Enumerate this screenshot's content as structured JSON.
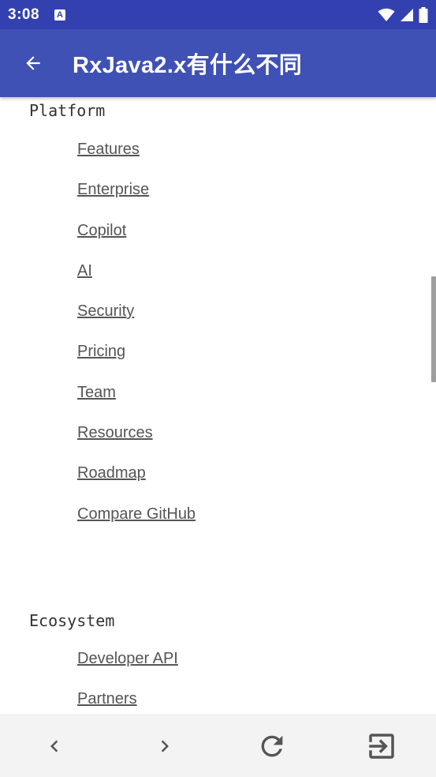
{
  "status_bar": {
    "time": "3:08",
    "notification_icon": "A"
  },
  "app_bar": {
    "back_icon": "arrow-back",
    "title": "RxJava2.x有什么不同"
  },
  "sections": [
    {
      "heading": "Platform",
      "links": [
        "Features",
        "Enterprise",
        "Copilot",
        "AI",
        "Security",
        "Pricing",
        "Team",
        "Resources",
        "Roadmap",
        "Compare GitHub"
      ]
    },
    {
      "heading": "Ecosystem",
      "links": [
        "Developer API",
        "Partners"
      ]
    }
  ],
  "bottom_bar": {
    "buttons": [
      "chevron-left",
      "chevron-right",
      "refresh",
      "exit-to-app"
    ]
  },
  "colors": {
    "status_bar": "#3341b0",
    "app_bar": "#3f51b5",
    "link_text": "#555555",
    "bottom_bar": "#f3f3f3"
  }
}
